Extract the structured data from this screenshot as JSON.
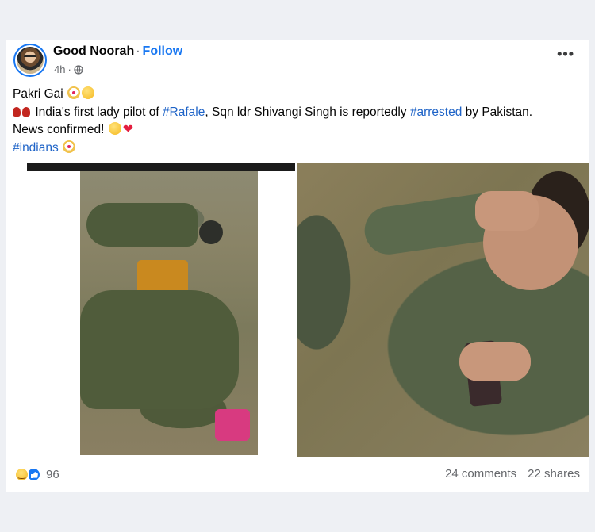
{
  "post": {
    "author": "Good Noorah",
    "separator": "·",
    "follow_label": "Follow",
    "timestamp": "4h",
    "privacy_icon": "globe-icon",
    "more_icon": "more-options-icon",
    "more_label": "•••",
    "text": {
      "line1": "Pakri Gai",
      "line2_pre": "India's first lady pilot of ",
      "line2_tag1": "#Rafale",
      "line2_mid": ", Sqn ldr Shivangi Singh is reportedly ",
      "line2_tag2": "#arrested",
      "line2_post": " by Pakistan.",
      "line3": "News confirmed!",
      "line4_tag": "#indians"
    },
    "images": [
      {
        "name": "post-image-left"
      },
      {
        "name": "post-image-right"
      }
    ]
  },
  "footer": {
    "reaction_icons": [
      "haha-reaction-icon",
      "like-reaction-icon"
    ],
    "reaction_count": "96",
    "comments": "24 comments",
    "shares": "22 shares"
  },
  "colors": {
    "accent": "#1877f2",
    "hashtag": "#1e63c7",
    "muted": "#65676b",
    "background": "#eef0f4"
  }
}
